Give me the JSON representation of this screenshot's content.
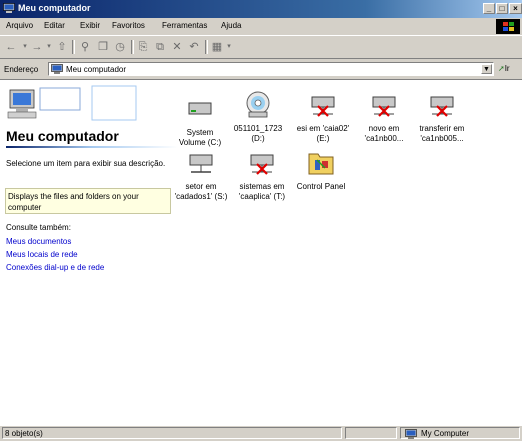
{
  "window": {
    "title": "Meu computador",
    "controls": [
      "minimize-icon",
      "maximize-icon",
      "close-icon"
    ]
  },
  "menu": [
    "Arquivo",
    "Editar",
    "Exibir",
    "Favoritos",
    "Ferramentas",
    "Ajuda"
  ],
  "toolbar": {
    "icons": [
      "back-arrow-icon",
      "forward-arrow-icon",
      "up-folder-icon",
      "search-icon",
      "folders-icon",
      "history-icon",
      "move-to-icon",
      "copy-to-icon",
      "delete-icon",
      "undo-icon",
      "views-icon"
    ]
  },
  "address": {
    "label": "Endereço",
    "value": "Meu computador",
    "go": "Ir"
  },
  "left_panel": {
    "heading": "Meu computador",
    "description": "Selecione um item para exibir sua descrição.",
    "info": "Displays the files and folders on your computer",
    "see_also": "Consulte também:",
    "links": [
      "Meus documentos",
      "Meus locais de rede",
      "Conexões dial-up e de rede"
    ]
  },
  "items": [
    {
      "label1": "System",
      "label2": "Volume (C:)",
      "icon": "hard-drive-icon"
    },
    {
      "label1": "051101_1723",
      "label2": "(D:)",
      "icon": "cd-drive-icon"
    },
    {
      "label1": "esi em 'caia02'",
      "label2": "(E:)",
      "icon": "disconnected-network-drive-icon"
    },
    {
      "label1": "novo em",
      "label2": "'ca1nb00...",
      "icon": "disconnected-network-drive-icon"
    },
    {
      "label1": "transferir em",
      "label2": "'ca1nb005...",
      "icon": "disconnected-network-drive-icon"
    },
    {
      "label1": "setor em",
      "label2": "'cadados1' (S:)",
      "icon": "network-drive-icon"
    },
    {
      "label1": "sistemas em",
      "label2": "'caaplica' (T:)",
      "icon": "disconnected-network-drive-icon"
    },
    {
      "label1": "Control Panel",
      "label2": "",
      "icon": "control-panel-folder-icon"
    }
  ],
  "status": {
    "count": "8 objeto(s)",
    "zone": "My Computer"
  }
}
